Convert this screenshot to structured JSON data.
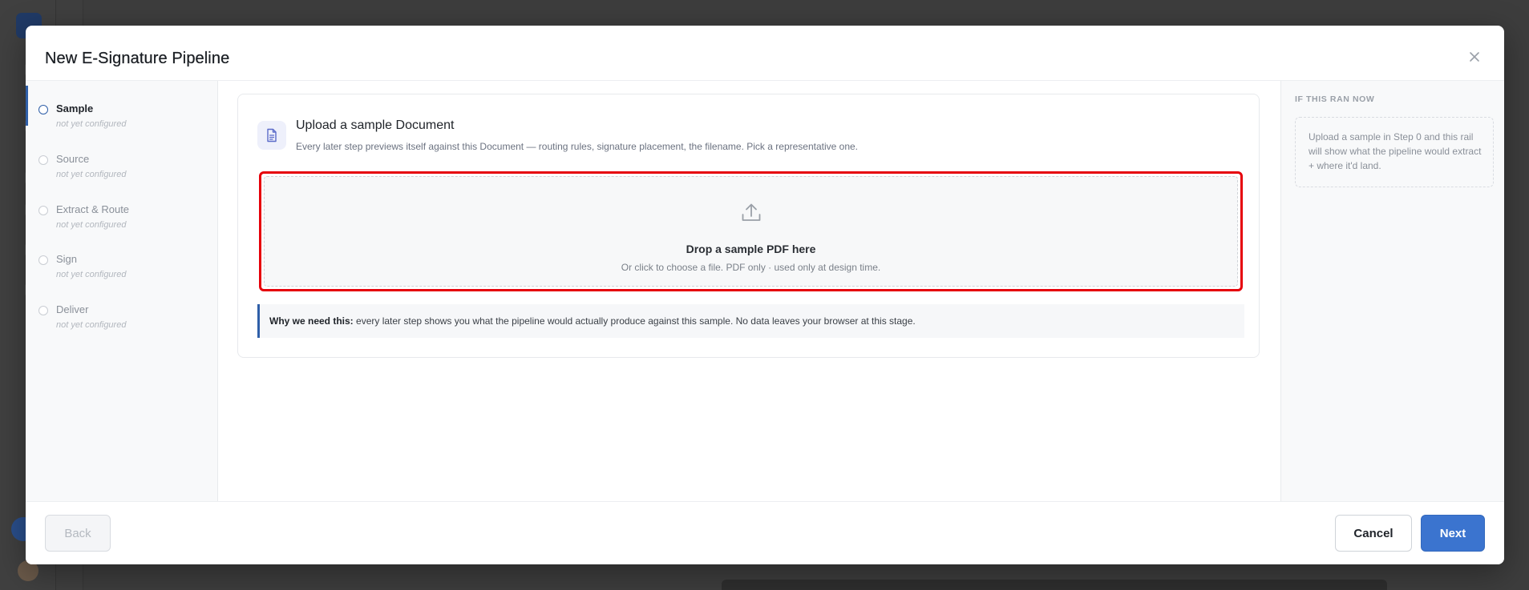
{
  "modal": {
    "title": "New E-Signature Pipeline"
  },
  "steps": [
    {
      "label": "Sample",
      "status": "not yet configured",
      "active": true
    },
    {
      "label": "Source",
      "status": "not yet configured",
      "active": false
    },
    {
      "label": "Extract & Route",
      "status": "not yet configured",
      "active": false
    },
    {
      "label": "Sign",
      "status": "not yet configured",
      "active": false
    },
    {
      "label": "Deliver",
      "status": "not yet configured",
      "active": false
    }
  ],
  "upload": {
    "title": "Upload a sample Document",
    "description": "Every later step previews itself against this Document — routing rules, signature placement, the filename. Pick a representative one.",
    "drop_title": "Drop a sample PDF here",
    "drop_subtitle": "Or click to choose a file. PDF only · used only at design time.",
    "callout_label": "Why we need this:",
    "callout_text": " every later step shows you what the pipeline would actually produce against this sample. No data leaves your browser at this stage."
  },
  "rail": {
    "heading": "IF THIS RAN NOW",
    "placeholder": "Upload a sample in Step 0 and this rail will show what the pipeline would extract + where it'd land."
  },
  "footer": {
    "back_label": "Back",
    "cancel_label": "Cancel",
    "next_label": "Next"
  },
  "icons": {
    "close": "close-icon",
    "document": "document-icon",
    "upload": "upload-icon"
  },
  "colors": {
    "accent": "#3b74cf",
    "highlight": "#e6000a",
    "active_step": "#2f5fa8"
  }
}
